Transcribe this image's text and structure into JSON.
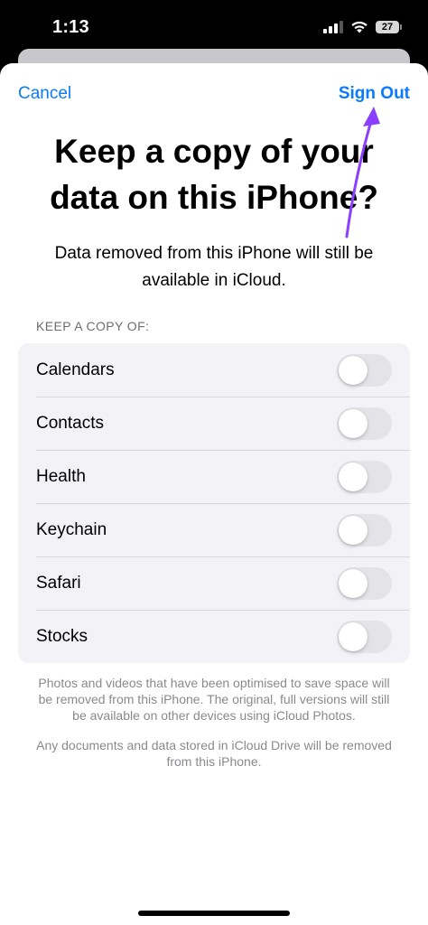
{
  "status_bar": {
    "time": "1:13",
    "battery": "27",
    "icons": [
      "signal-icon",
      "wifi-icon",
      "battery-icon"
    ]
  },
  "nav": {
    "cancel_label": "Cancel",
    "sign_out_label": "Sign Out"
  },
  "title": "Keep a copy of your data on this iPhone?",
  "subtitle": "Data removed from this iPhone will still be available in iCloud.",
  "section_header": "KEEP A COPY OF:",
  "items": [
    {
      "label": "Calendars",
      "enabled": false
    },
    {
      "label": "Contacts",
      "enabled": false
    },
    {
      "label": "Health",
      "enabled": false
    },
    {
      "label": "Keychain",
      "enabled": false
    },
    {
      "label": "Safari",
      "enabled": false
    },
    {
      "label": "Stocks",
      "enabled": false
    }
  ],
  "footer": {
    "photos_note": "Photos and videos that have been optimised to save space will be removed from this iPhone. The original, full versions will still be available on other devices using iCloud Photos.",
    "drive_note": "Any documents and data stored in iCloud Drive will be removed from this iPhone."
  },
  "colors": {
    "accent": "#0a7aff",
    "annotation_arrow": "#8a3ffc",
    "toggle_off": "#e3e3e8"
  }
}
